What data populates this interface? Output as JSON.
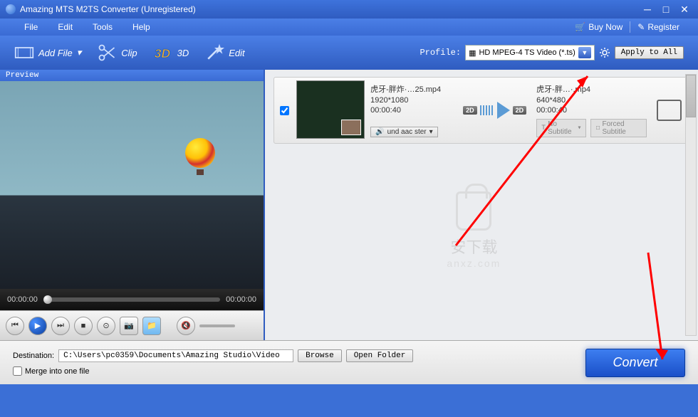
{
  "title": "Amazing MTS M2TS Converter (Unregistered)",
  "menu": {
    "file": "File",
    "edit": "Edit",
    "tools": "Tools",
    "help": "Help"
  },
  "header": {
    "buynow": "Buy Now",
    "register": "Register"
  },
  "toolbar": {
    "addfile": "Add File",
    "clip": "Clip",
    "3d": "3D",
    "edit": "Edit",
    "profile_label": "Profile:",
    "profile_value": "HD MPEG-4 TS Video (*.ts)",
    "apply_all": "Apply to All"
  },
  "preview": {
    "label": "Preview",
    "time_current": "00:00:00",
    "time_total": "00:00:00"
  },
  "file": {
    "checked": true,
    "src_name": "虎牙-胖炸·…25.mp4",
    "src_res": "1920*1080",
    "src_dur": "00:00:40",
    "audio": "und aac ster",
    "subtitle": "No Subtitle",
    "forced": "Forced Subtitle",
    "out_name": "虎牙-胖…·.mp4",
    "out_res": "640*480",
    "out_dur": "00:00:40",
    "badge": "2D"
  },
  "watermark": {
    "line1": "安下载",
    "line2": "anxz.com"
  },
  "bottom": {
    "dest_label": "Destination:",
    "dest_value": "C:\\Users\\pc0359\\Documents\\Amazing Studio\\Video",
    "browse": "Browse",
    "openfolder": "Open Folder",
    "merge": "Merge into one file",
    "convert": "Convert"
  }
}
